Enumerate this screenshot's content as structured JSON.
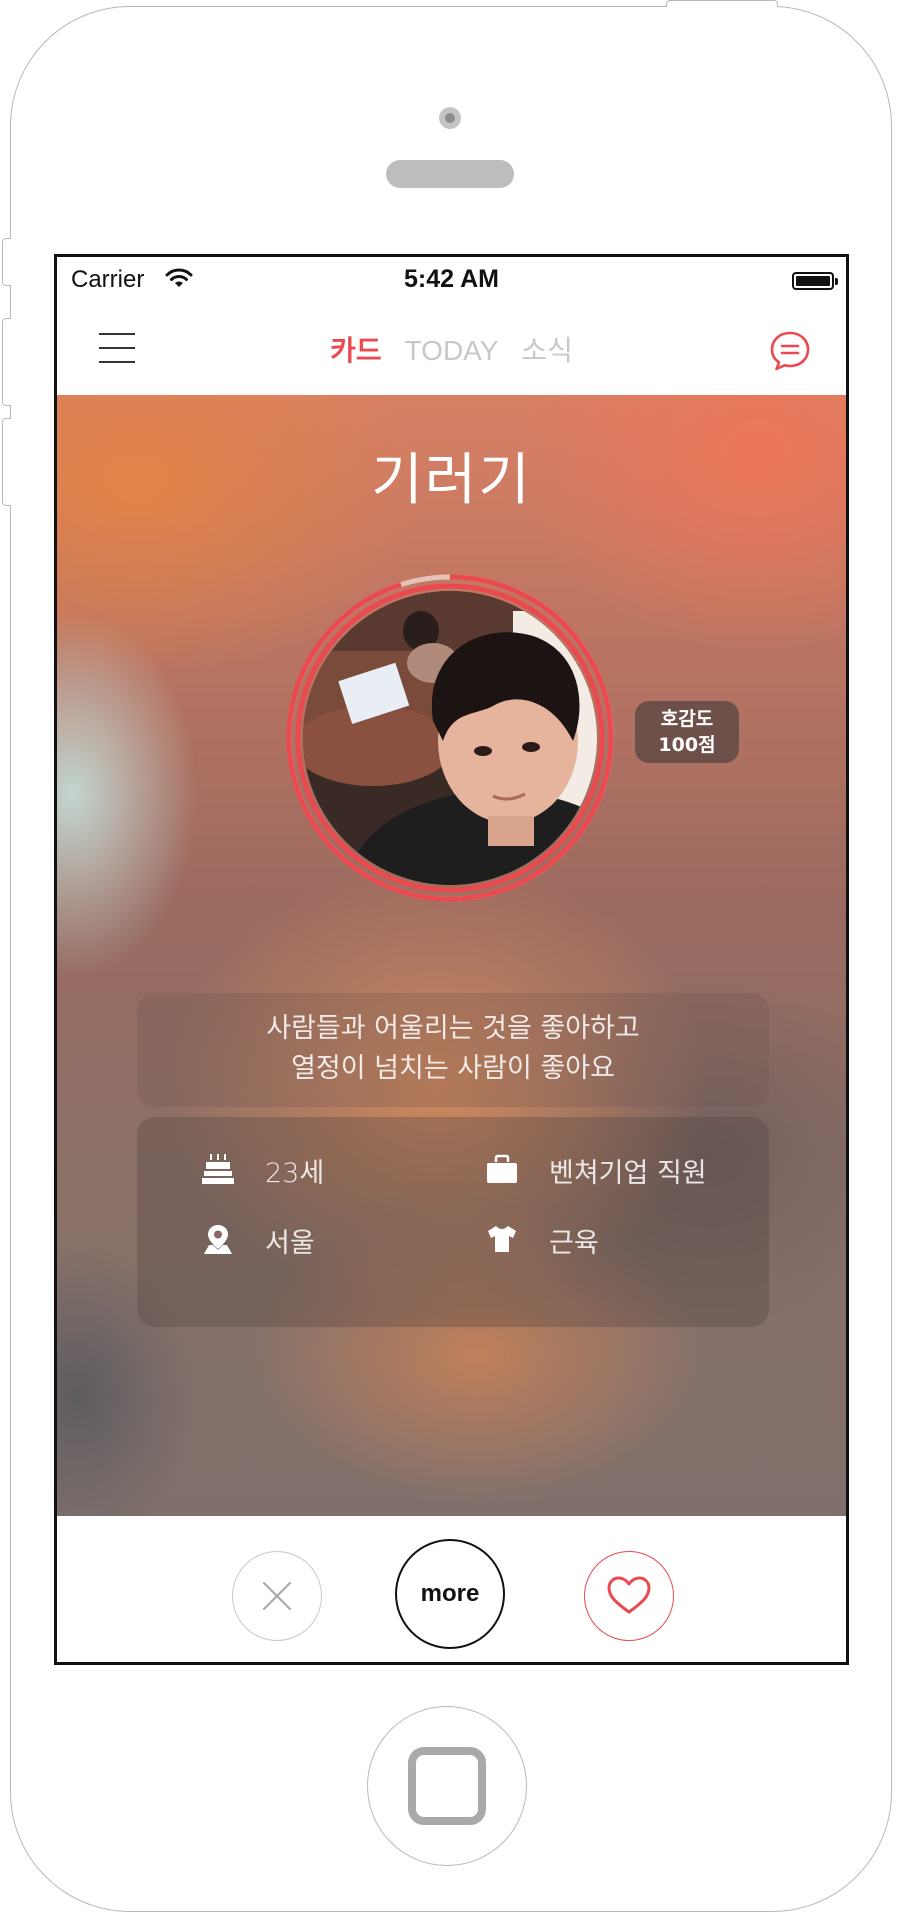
{
  "status_bar": {
    "carrier": "Carrier",
    "time": "5:42 AM"
  },
  "nav": {
    "tabs": [
      {
        "label": "카드",
        "active": true
      },
      {
        "label": "TODAY",
        "active": false
      },
      {
        "label": "소식",
        "active": false
      }
    ]
  },
  "profile": {
    "name": "기러기",
    "score_label": "호감도",
    "score_value": "100점",
    "bio_line1": "사람들과 어울리는 것을 좋아하고",
    "bio_line2": "열정이 넘치는 사람이 좋아요",
    "info": {
      "age": "23세",
      "job": "벤쳐기업 직원",
      "location": "서울",
      "body_type": "근육"
    }
  },
  "actions": {
    "more_label": "more"
  },
  "colors": {
    "accent": "#ea4a4f",
    "tab_inactive": "#c8c8c8"
  },
  "icons": [
    "menu-icon",
    "chat-icon",
    "wifi-icon",
    "battery-icon",
    "cake-icon",
    "briefcase-icon",
    "location-icon",
    "shirt-icon",
    "close-icon",
    "heart-icon"
  ]
}
